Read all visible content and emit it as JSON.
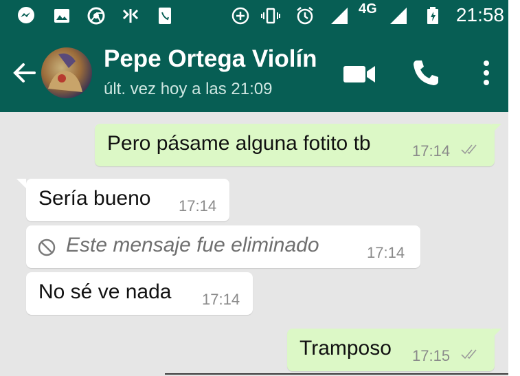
{
  "status_bar": {
    "network": "4G",
    "time": "21:58"
  },
  "header": {
    "contact_name": "Pepe Ortega Violín",
    "last_seen": "últ. vez hoy a las 21:09"
  },
  "messages": [
    {
      "direction": "outgoing",
      "text": "Pero pásame alguna fotito tb",
      "time": "17:14",
      "status": "read-double-check"
    },
    {
      "direction": "incoming",
      "text": "Sería bueno",
      "time": "17:14"
    },
    {
      "direction": "incoming",
      "text": "Este mensaje fue eliminado",
      "time": "17:14",
      "deleted": true
    },
    {
      "direction": "incoming",
      "text": "No sé ve nada",
      "time": "17:14"
    },
    {
      "direction": "outgoing",
      "text": "Tramposo",
      "time": "17:15",
      "status": "read-double-check"
    }
  ],
  "colors": {
    "app_bar": "#075e54",
    "chat_background": "#e6e6e6",
    "outgoing_bubble": "#dcf8c6",
    "incoming_bubble": "#ffffff"
  },
  "icons": [
    "messenger-icon",
    "gallery-icon",
    "chrome-icon",
    "app-icon",
    "phone-app-icon",
    "data-saver-icon",
    "vibrate-icon",
    "alarm-icon",
    "signal-icon",
    "battery-charging-icon",
    "back-arrow-icon",
    "video-call-icon",
    "voice-call-icon",
    "more-options-icon",
    "blocked-icon",
    "double-check-icon"
  ]
}
